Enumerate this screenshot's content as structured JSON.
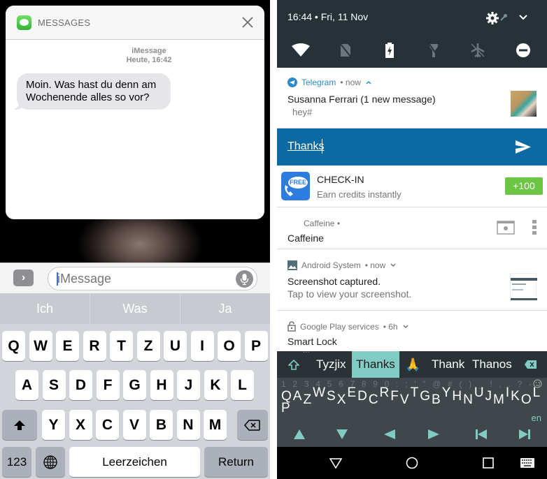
{
  "ios": {
    "notification": {
      "app_name": "MESSAGES",
      "service": "iMessage",
      "timestamp": "Heute, 16:42",
      "message": "Moin. Was hast du denn am Wochenende alles so vor?",
      "close_icon": "close-icon"
    },
    "input": {
      "placeholder": "iMessage",
      "apps_icon": "chevron-right-icon",
      "mic_icon": "microphone-icon"
    },
    "keyboard": {
      "suggestions": [
        "Ich",
        "Was",
        "Ja"
      ],
      "row1": [
        "Q",
        "W",
        "E",
        "R",
        "T",
        "Z",
        "U",
        "I",
        "O",
        "P"
      ],
      "row2": [
        "A",
        "S",
        "D",
        "F",
        "G",
        "H",
        "J",
        "K",
        "L"
      ],
      "row3": [
        "Y",
        "X",
        "C",
        "V",
        "B",
        "N",
        "M"
      ],
      "numbers_label": "123",
      "space_label": "Leerzeichen",
      "return_label": "Return"
    }
  },
  "android": {
    "status": {
      "time_date": "16:44 • Fri, 11 Nov"
    },
    "quick_settings": [
      "wifi-icon",
      "no-sim-icon",
      "battery-charging-icon",
      "flashlight-off-icon",
      "airplane-mode-off-icon",
      "do-not-disturb-icon"
    ],
    "notifications": {
      "telegram": {
        "app": "Telegram",
        "time": "• now",
        "title": "Susanna Ferrari (1 new message)",
        "text": "hey#",
        "reply_value": "Thanks"
      },
      "checkin": {
        "title": "CHECK-IN",
        "text": "Earn credits instantly",
        "badge_label": "FREE",
        "button_label": "+100",
        "button_color": "#6cc644"
      },
      "caffeine": {
        "app": "Caffeine •",
        "title": "Caffeine"
      },
      "android_system": {
        "app": "Android System",
        "time": "• now",
        "title": "Screenshot captured.",
        "text": "Tap to view your screenshot."
      },
      "play_services": {
        "app": "Google Play services",
        "time": "• 6h",
        "title": "Smart Lock"
      }
    },
    "keyboard": {
      "suggestions": [
        "Tyzjix",
        "Thanks",
        "🙏",
        "Thank",
        "Thanos"
      ],
      "selected_suggestion": "Thanks",
      "number_row": "1 2 3 4 5 6 7 8 9 0 : ; ' \" @ # ( ) _ ! , . ? - /",
      "letter_keys": [
        "Q",
        "A",
        "Z",
        "W",
        "S",
        "X",
        "E",
        "D",
        "C",
        "R",
        "F",
        "V",
        "T",
        "G",
        "B",
        "Y",
        "H",
        "N",
        "U",
        "J",
        "M",
        "I",
        "K",
        "O",
        "L",
        "P"
      ],
      "language": "en",
      "accent_color": "#80cbc4"
    }
  }
}
